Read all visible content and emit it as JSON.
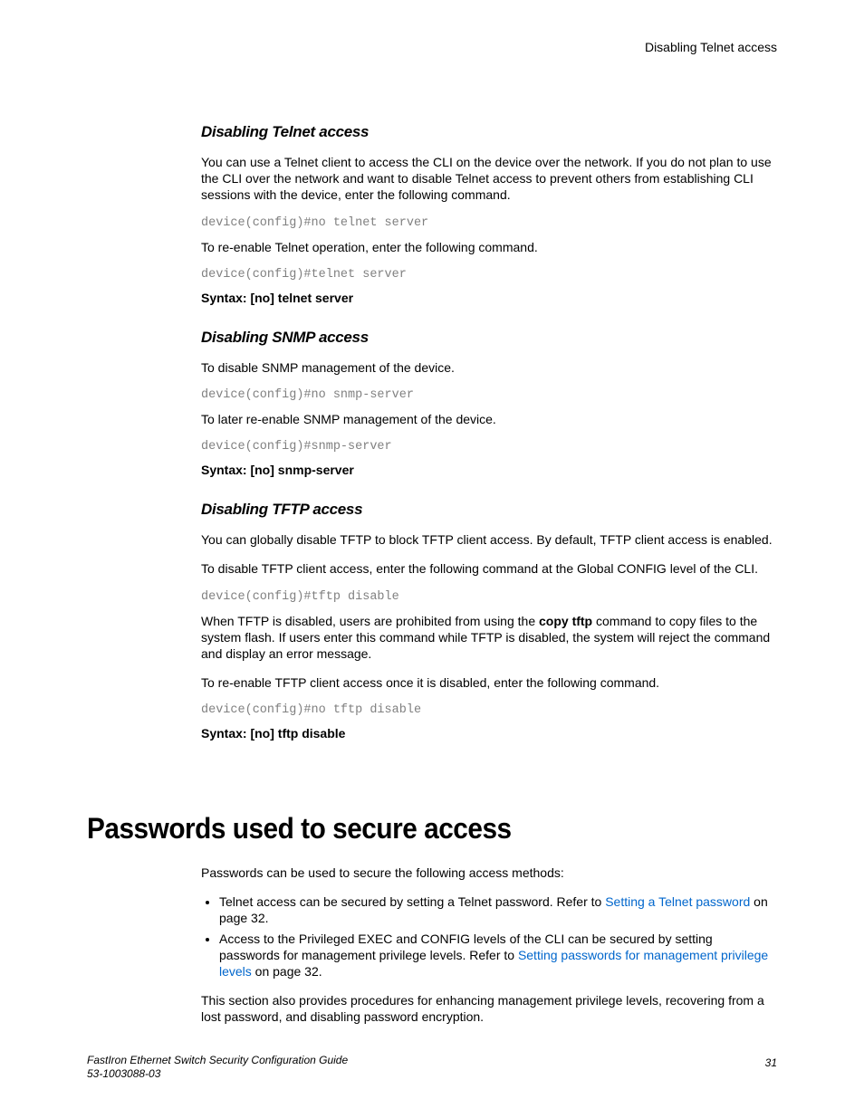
{
  "running_head": "Disabling Telnet access",
  "sections": {
    "telnet": {
      "heading": "Disabling Telnet access",
      "p1": "You can use a Telnet client to access the CLI on the device over the network. If you do not plan to use the CLI over the network and want to disable Telnet access to prevent others from establishing CLI sessions with the device, enter the following command.",
      "code1": "device(config)#no telnet server",
      "p2": "To re-enable Telnet operation, enter the following command.",
      "code2": "device(config)#telnet server",
      "syntax": "Syntax: [no] telnet server"
    },
    "snmp": {
      "heading": "Disabling SNMP access",
      "p1": "To disable SNMP management of the device.",
      "code1": "device(config)#no snmp-server",
      "p2": "To later re-enable SNMP management of the device.",
      "code2": "device(config)#snmp-server",
      "syntax": "Syntax: [no] snmp-server"
    },
    "tftp": {
      "heading": "Disabling TFTP access",
      "p1": "You can globally disable TFTP to block TFTP client access. By default, TFTP client access is enabled.",
      "p2": "To disable TFTP client access, enter the following command at the Global CONFIG level of the CLI.",
      "code1": "device(config)#tftp disable",
      "p3a": "When TFTP is disabled, users are prohibited from using the ",
      "p3b_bold": "copy tftp",
      "p3c": " command to copy files to the system flash. If users enter this command while TFTP is disabled, the system will reject the command and display an error message.",
      "p4": "To re-enable TFTP client access once it is disabled, enter the following command.",
      "code2": "device(config)#no tftp disable",
      "syntax": "Syntax: [no] tftp disable"
    }
  },
  "main_heading": "Passwords used to secure access",
  "passwords": {
    "intro": "Passwords can be used to secure the following access methods:",
    "li1a": "Telnet access can be secured by setting a Telnet password. Refer to ",
    "li1_link": "Setting a Telnet password",
    "li1b": " on page 32.",
    "li2a": "Access to the Privileged EXEC and CONFIG levels of the CLI can be secured by setting passwords for management privilege levels. Refer to ",
    "li2_link": "Setting passwords for management privilege levels",
    "li2b": " on page 32.",
    "outro": "This section also provides procedures for enhancing management privilege levels, recovering from a lost password, and disabling password encryption."
  },
  "footer": {
    "title": "FastIron Ethernet Switch Security Configuration Guide",
    "docnum": "53-1003088-03",
    "page": "31"
  }
}
